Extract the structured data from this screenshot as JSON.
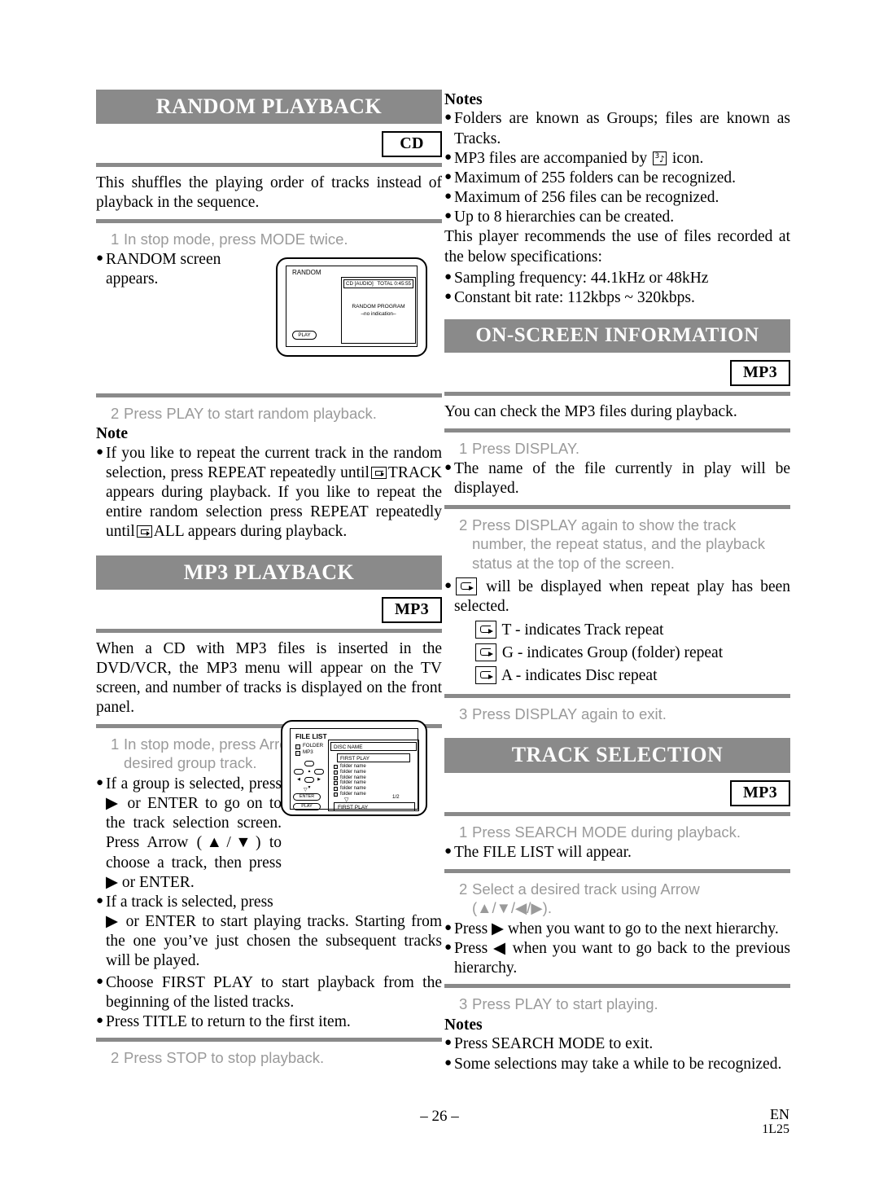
{
  "document": {
    "page_number": "– 26 –",
    "language_code": "EN",
    "doc_code": "1L25"
  },
  "left_column": {
    "random_playback": {
      "title": "RANDOM PLAYBACK",
      "badge": "CD",
      "intro": "This shuffles the playing order of tracks instead of playback in the sequence.",
      "step1_num": "1",
      "step1_text": "In stop mode, press MODE twice.",
      "step1_bullet": "RANDOM screen appears.",
      "step2_num": "2",
      "step2_text": "Press PLAY to start random playback.",
      "note_heading": "Note",
      "note_bullet_a": "If you like to repeat the current track in the random selection, press REPEAT repeatedly until",
      "note_bullet_b": "TRACK appears during playback. If you like to repeat the entire random selection press REPEAT repeatedly until",
      "note_bullet_c": "ALL appears during playback."
    },
    "random_screen": {
      "screen_label": "RANDOM",
      "status_left": "CD [AUDIO]",
      "status_right": "TOTAL 0:45:55",
      "center_line1": "RANDOM PROGRAM",
      "center_line2": "–no indication–",
      "play_button": "PLAY"
    },
    "mp3_playback": {
      "title": "MP3 PLAYBACK",
      "badge": "MP3",
      "intro": "When a CD with MP3 files is inserted in the DVD/VCR, the MP3 menu will appear on the TV screen, and number of tracks is displayed on the front panel.",
      "step1_num": "1",
      "step1_text_a": "In stop mode, press Arrow (",
      "step1_arrows": "▲/▼",
      "step1_text_b": ") to select the desired group track.",
      "bullet1": "If a group is selected, press ▶ or ENTER to go on to the track selection screen. Press Arrow (▲/▼) to choose a track, then press ▶ or ENTER.",
      "bullet2": "If a track is selected, press ▶ or ENTER to start playing tracks. Starting from the one you've just chosen the subsequent tracks will be played.",
      "bullet3": "Choose FIRST PLAY to start playback from the beginning of the listed tracks.",
      "bullet4": "Press TITLE to return to the first item.",
      "step2_num": "2",
      "step2_text": "Press STOP to stop playback."
    },
    "file_list_screen": {
      "screen_label": "FILE LIST",
      "legend_folder": "FOLDER",
      "legend_mp3": "MP3",
      "disc_name": "DISC NAME",
      "first_play_top": "FIRST PLAY",
      "folder_items": [
        "folder name",
        "folder name",
        "folder name",
        "folder name",
        "folder name",
        "folder name"
      ],
      "page_indicator": "1/2",
      "first_play_bottom": "FIRST PLAY",
      "enter_button": "ENTER",
      "play_button": "PLAY"
    }
  },
  "right_column": {
    "mp3_notes": {
      "heading": "Notes",
      "bullet1": "Folders are known as Groups; files are known as Tracks.",
      "bullet2_a": "MP3 files are accompanied by",
      "bullet2_b": "icon.",
      "bullet3": "Maximum of 255 folders can be recognized.",
      "bullet4": "Maximum of 256 files can be recognized.",
      "bullet5": "Up to 8 hierarchies can be created.",
      "paragraph": "This player recommends the use of files recorded at the below specifications:",
      "bullet6": "Sampling frequency: 44.1kHz or 48kHz",
      "bullet7": "Constant bit rate: 112kbps ~ 320kbps."
    },
    "on_screen_information": {
      "title": "ON-SCREEN INFORMATION",
      "badge": "MP3",
      "intro": "You can check the MP3 files during playback.",
      "step1_num": "1",
      "step1_text": "Press DISPLAY.",
      "bullet1": "The name of the file currently in play will be displayed.",
      "step2_num": "2",
      "step2_text": "Press DISPLAY again to show the track number, the repeat status, and the playback status at the top of the screen.",
      "bullet2": "will be displayed when repeat play has been selected.",
      "repeat_t": "T - indicates Track repeat",
      "repeat_g": "G - indicates Group (folder) repeat",
      "repeat_a": "A - indicates Disc repeat",
      "step3_num": "3",
      "step3_text": "Press DISPLAY again to exit."
    },
    "track_selection": {
      "title": "TRACK SELECTION",
      "badge": "MP3",
      "step1_num": "1",
      "step1_text": "Press SEARCH MODE during playback.",
      "bullet1": "The FILE LIST will appear.",
      "step2_num": "2",
      "step2_text_a": "Select a desired track using Arrow",
      "step2_text_b": "(▲/▼/◀/▶).",
      "bullet2": "Press ▶ when you want to go to the next hierarchy.",
      "bullet3": "Press ◀ when you want to go back to the previous hierarchy.",
      "step3_num": "3",
      "step3_text": "Press PLAY to start playing.",
      "notes_heading": "Notes",
      "note1": "Press SEARCH MODE to exit.",
      "note2": "Some selections may take a while to be recognized."
    }
  },
  "colors": {
    "header_bar": "#8a8a8a",
    "step_text": "#9a9a9a",
    "body_text": "#000000"
  }
}
